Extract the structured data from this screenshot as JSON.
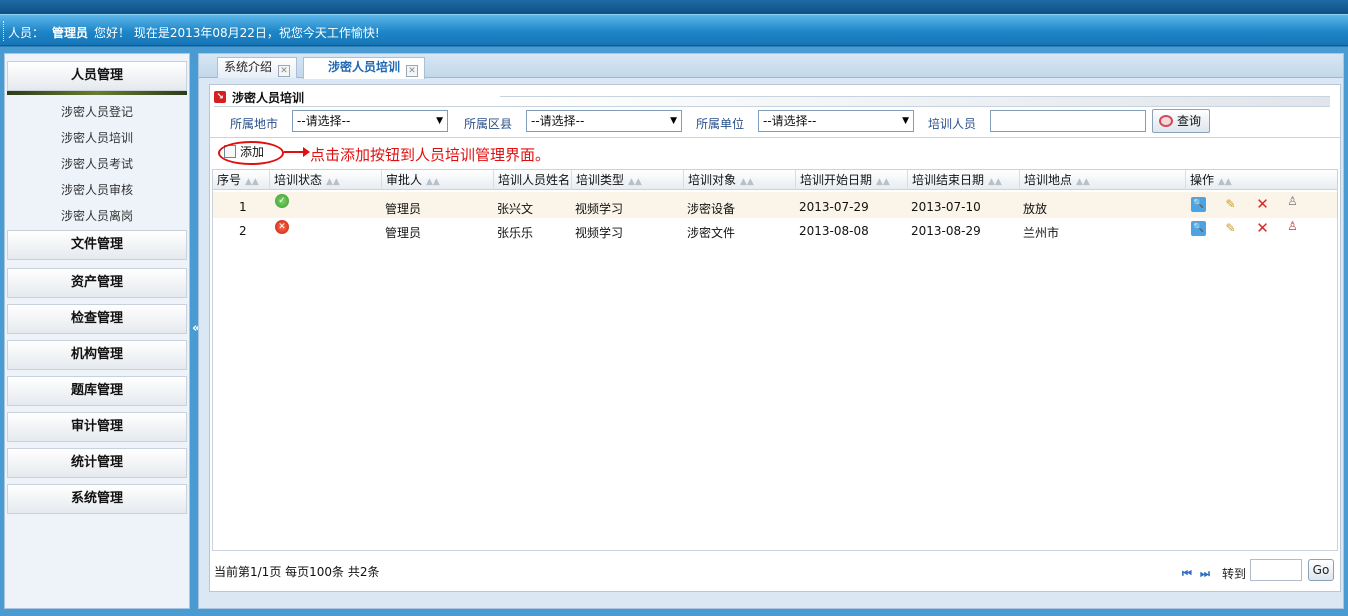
{
  "header": {
    "user_label": "人员：",
    "user_name": "管理员",
    "greeting": "您好！ 现在是2013年08月22日，祝您今天工作愉快!"
  },
  "sidebar": {
    "active_group": "人员管理",
    "sub_items": [
      "涉密人员登记",
      "涉密人员培训",
      "涉密人员考试",
      "涉密人员审核",
      "涉密人员离岗"
    ],
    "groups": [
      "文件管理",
      "资产管理",
      "检查管理",
      "机构管理",
      "题库管理",
      "审计管理",
      "统计管理",
      "系统管理"
    ],
    "collapse_symbol": "«"
  },
  "tabs": [
    {
      "label": "系统介绍",
      "active": false
    },
    {
      "label": "涉密人员培训",
      "active": true
    }
  ],
  "panel": {
    "title": "涉密人员培训"
  },
  "filters": {
    "city_label": "所属地市",
    "city_value": "--请选择--",
    "district_label": "所属区县",
    "district_value": "--请选择--",
    "unit_label": "所属单位",
    "unit_value": "--请选择--",
    "person_label": "培训人员",
    "person_value": "",
    "query_label": "查询"
  },
  "toolbar": {
    "add_label": "添加",
    "annotation": "点击添加按钮到人员培训管理界面。"
  },
  "table": {
    "columns": [
      "序号",
      "培训状态",
      "审批人",
      "培训人员姓名",
      "培训类型",
      "培训对象",
      "培训开始日期",
      "培训结束日期",
      "培训地点",
      "操作"
    ],
    "rows": [
      {
        "no": "1",
        "status": "approved",
        "approver": "管理员",
        "name": "张兴文",
        "type": "视频学习",
        "target": "涉密设备",
        "start": "2013-07-29",
        "end": "2013-07-10",
        "place": "放放"
      },
      {
        "no": "2",
        "status": "rejected",
        "approver": "管理员",
        "name": "张乐乐",
        "type": "视频学习",
        "target": "涉密文件",
        "start": "2013-08-08",
        "end": "2013-08-29",
        "place": "兰州市"
      }
    ],
    "row_actions": [
      "view-icon",
      "edit-icon",
      "delete-icon",
      "stamp-icon"
    ]
  },
  "pager": {
    "info": "当前第1/1页  每页100条  共2条",
    "goto_label": "转到",
    "go_label": "Go",
    "goto_value": ""
  },
  "colors": {
    "header_blue": "#1e86c8",
    "annotation_red": "#e01010",
    "active_tab_text": "#1e68b1"
  }
}
